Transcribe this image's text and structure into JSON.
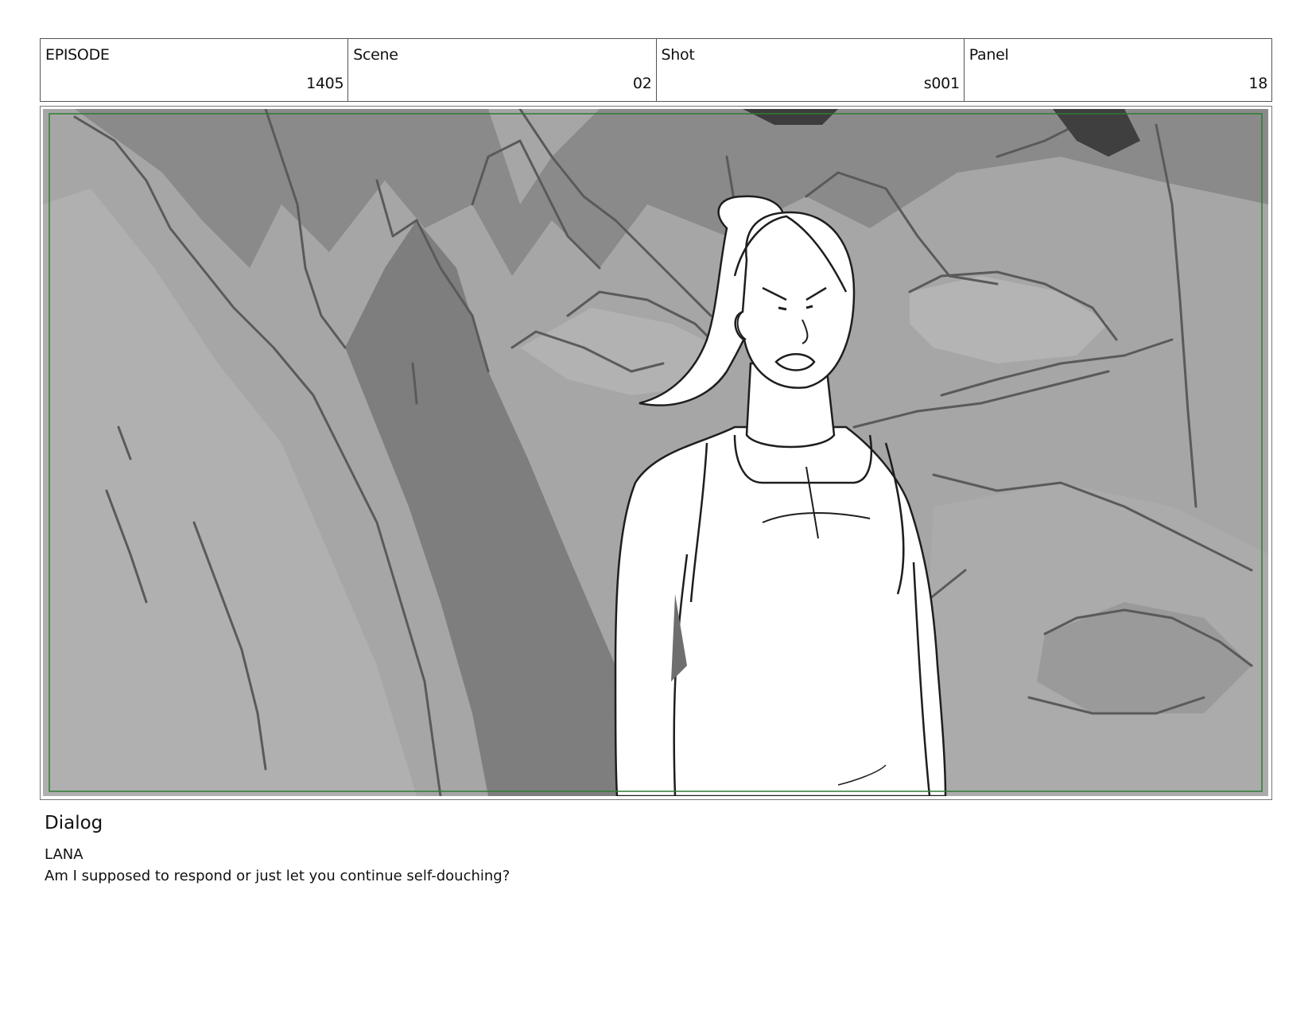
{
  "header": {
    "episode": {
      "label": "EPISODE",
      "value": "1405"
    },
    "scene": {
      "label": "Scene",
      "value": "02"
    },
    "shot": {
      "label": "Shot",
      "value": "s001"
    },
    "panel": {
      "label": "Panel",
      "value": "18"
    }
  },
  "dialog": {
    "title": "Dialog",
    "speaker": "LANA",
    "line": "Am I supposed to respond or just let you continue self-douching?"
  },
  "colors": {
    "safe_frame": "#2e7d32",
    "cell_border": "#555555"
  }
}
